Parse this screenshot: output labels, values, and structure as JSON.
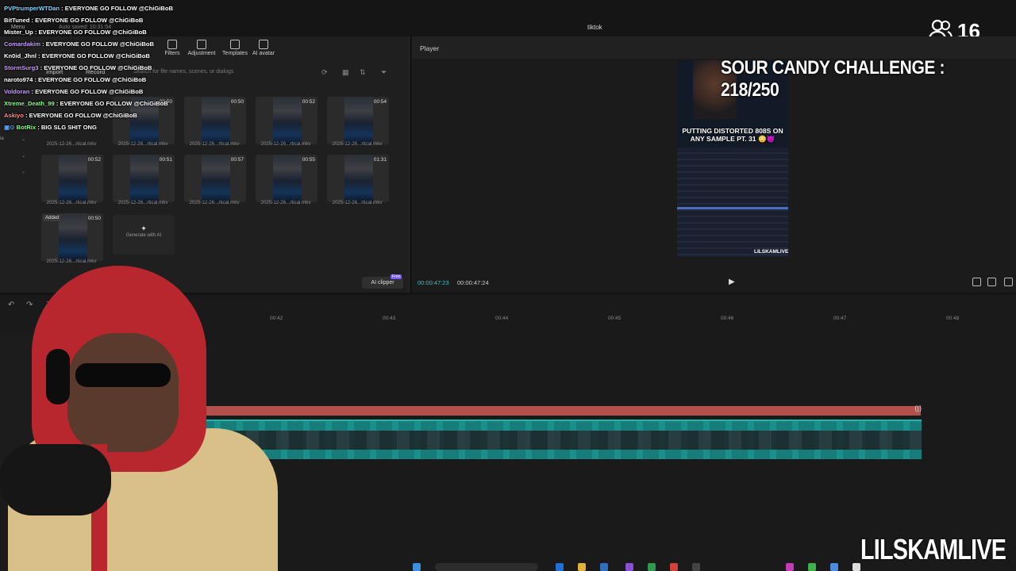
{
  "window": {
    "title": "tiktok"
  },
  "stream": {
    "viewer_count": "16",
    "challenge_text": "SOUR CANDY CHALLENGE : 218/250",
    "brand": "LILSKAMLIVE"
  },
  "app": {
    "menu_label": "Menu",
    "autosave": "Auto saved: 10:31:54",
    "tools": [
      "Filters",
      "Adjustment",
      "Templates",
      "AI avatar"
    ],
    "import_label": "Import",
    "record_label": "Record",
    "search_placeholder": "Search for file names, scenes, or dialogs",
    "generate_ai_label": "Generate with AI",
    "ai_clipper_label": "AI clipper",
    "ai_clipper_badge": "Free",
    "side_filters": [
      "ia",
      "",
      ""
    ]
  },
  "media": {
    "clips": [
      {
        "duration": "00:50",
        "name": "2025-12-26...rtical.mkv",
        "added": ""
      },
      {
        "duration": "00:50",
        "name": "2025-12-26...rtical.mkv",
        "added": ""
      },
      {
        "duration": "00:52",
        "name": "2025-12-26...rtical.mkv",
        "added": ""
      },
      {
        "duration": "00:54",
        "name": "2025-12-26...rtical.mkv",
        "added": ""
      },
      {
        "duration": "",
        "name": "2025-12-26...rtical.mkv",
        "added": ""
      },
      {
        "duration": "00:52",
        "name": "2025-12-26...rtical.mkv",
        "added": ""
      },
      {
        "duration": "00:51",
        "name": "2025-12-26...rtical.mkv",
        "added": ""
      },
      {
        "duration": "00:57",
        "name": "2025-12-26...rtical.mkv",
        "added": ""
      },
      {
        "duration": "00:55",
        "name": "2025-12-26...rtical.mkv",
        "added": ""
      },
      {
        "duration": "01:31",
        "name": "2025-12-26...rtical.mkv",
        "added": ""
      },
      {
        "duration": "00:50",
        "name": "2025-12-26...rtical.mkv",
        "added": "Added"
      }
    ]
  },
  "chat": [
    {
      "user": "PVPtrumperWTDan",
      "message": "EVERYONE GO FOLLOW @ChiGiBoB",
      "color": "#7ad7ff"
    },
    {
      "user": "BitTuned",
      "message": "EVERYONE GO FOLLOW @ChiGiBoB",
      "color": "#ffffff"
    },
    {
      "user": "Mister_Up",
      "message": "EVERYONE GO FOLLOW @ChiGiBoB",
      "color": "#ffffff"
    },
    {
      "user": "Comardakim",
      "message": "EVERYONE GO FOLLOW @ChiGiBoB",
      "color": "#c79bff"
    },
    {
      "user": "Kn0id_Jhnl",
      "message": "EVERYONE GO FOLLOW @ChiGiBoB",
      "color": "#ffffff"
    },
    {
      "user": "StormSurg3",
      "message": "EVERYONE GO FOLLOW @ChiGiBoB",
      "color": "#c79bff"
    },
    {
      "user": "naroto974",
      "message": "EVERYONE GO FOLLOW @ChiGiBoB",
      "color": "#ffffff"
    },
    {
      "user": "Voldoran",
      "message": "EVERYONE GO FOLLOW @ChiGiBoB",
      "color": "#c79bff"
    },
    {
      "user": "Xtreme_Death_99",
      "message": "EVERYONE GO FOLLOW @ChiGiBoB",
      "color": "#7dff7d"
    },
    {
      "user": "Askiyo",
      "message": "EVERYONE GO FOLLOW @ChiGiBoB",
      "color": "#ff8a8a"
    },
    {
      "user": "BotRix",
      "message": "BIG SLG SHIT ONG",
      "color": "#7dff7d"
    }
  ],
  "player": {
    "title": "Player",
    "preview_caption": "PUTTING DISTORTED 808S ON ANY SAMPLE PT. 31 😳😈",
    "preview_watermark": "LILSKAMLIVE",
    "current_time": "00:00:47:23",
    "total_time": "00:00:47:24"
  },
  "timeline": {
    "ruler_ticks": [
      "00:42",
      "00:43",
      "00:44",
      "00:45",
      "00:46",
      "00:47",
      "00:48"
    ]
  },
  "colors": {
    "accent": "#2fc6c6",
    "audio_track": "#b2504b",
    "video_track": "#167d7a"
  }
}
